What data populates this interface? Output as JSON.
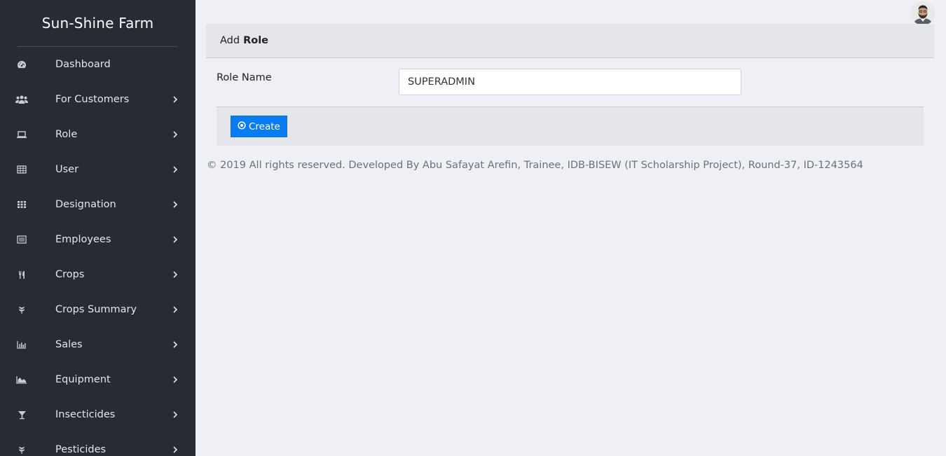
{
  "brand": {
    "title": "Sun-Shine Farm"
  },
  "sidebar": {
    "items": [
      {
        "label": "Dashboard",
        "icon": "dashboard-icon",
        "has_submenu": false
      },
      {
        "label": "For Customers",
        "icon": "users-icon",
        "has_submenu": true
      },
      {
        "label": "Role",
        "icon": "laptop-icon",
        "has_submenu": true
      },
      {
        "label": "User",
        "icon": "table-icon",
        "has_submenu": true
      },
      {
        "label": "Designation",
        "icon": "grid-icon",
        "has_submenu": true
      },
      {
        "label": "Employees",
        "icon": "list-icon",
        "has_submenu": true
      },
      {
        "label": "Crops",
        "icon": "cutlery-icon",
        "has_submenu": true
      },
      {
        "label": "Crops Summary",
        "icon": "leaf-icon",
        "has_submenu": true
      },
      {
        "label": "Sales",
        "icon": "bar-chart-icon",
        "has_submenu": true
      },
      {
        "label": "Equipment",
        "icon": "area-chart-icon",
        "has_submenu": true
      },
      {
        "label": "Insecticides",
        "icon": "glass-icon",
        "has_submenu": true
      },
      {
        "label": "Pesticides",
        "icon": "leaf-icon",
        "has_submenu": true
      }
    ]
  },
  "header": {
    "avatar": "user-avatar"
  },
  "card": {
    "title_prefix": "Add",
    "title_bold": "Role",
    "field_label": "Role Name",
    "field_value": "SUPERADMIN",
    "create_label": "Create"
  },
  "footer": {
    "copyright": "© 2019 All rights reserved. Developed By Abu Safayat Arefin, Trainee, IDB-BISEW (IT Scholarship Project), Round-37, ID-1243564"
  },
  "colors": {
    "sidebar_bg": "#272b33",
    "page_bg": "#eef0f5",
    "primary": "#0a7bf1"
  }
}
